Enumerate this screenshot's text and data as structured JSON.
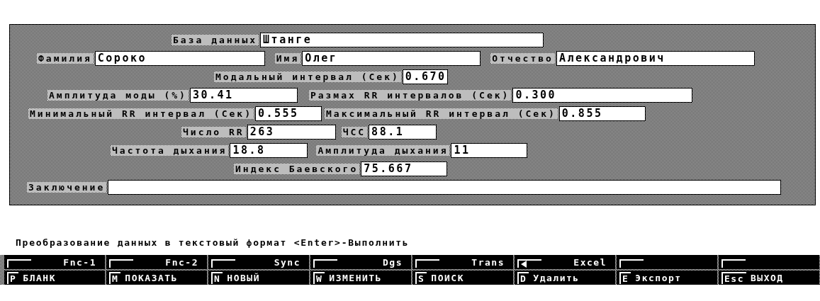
{
  "form": {
    "rows": [
      {
        "fields": [
          {
            "label": "База данных",
            "value": "Штанге"
          }
        ]
      },
      {
        "fields": [
          {
            "label": "Фамилия",
            "value": "Сороко"
          },
          {
            "label": "Имя",
            "value": "Олег"
          },
          {
            "label": "Отчество",
            "value": "Александрович"
          }
        ]
      },
      {
        "fields": [
          {
            "label": "Модальный интервал (Сек)",
            "value": "0.670"
          }
        ]
      },
      {
        "fields": [
          {
            "label": "Амплитуда моды (%)",
            "value": "30.41"
          },
          {
            "label": "Размах RR интервалов (Сек)",
            "value": "0.300"
          }
        ]
      },
      {
        "fields": [
          {
            "label": "Минимальный RR интервал (Сек)",
            "value": "0.555"
          },
          {
            "label": "Максимальный RR интервал (Сек)",
            "value": "0.855"
          }
        ]
      },
      {
        "fields": [
          {
            "label": "Число RR",
            "value": "263"
          },
          {
            "label": "ЧСС",
            "value": "88.1"
          }
        ]
      },
      {
        "fields": [
          {
            "label": "Частота дыхания",
            "value": "18.8"
          },
          {
            "label": "Амплитуда дыхания",
            "value": "11"
          }
        ]
      },
      {
        "fields": [
          {
            "label": "Индекс Баевского",
            "value": "75.667"
          }
        ]
      },
      {
        "fields": [
          {
            "label": "Заключение"
          }
        ]
      }
    ]
  },
  "status": "Преобразование данных в текстовый формат <Enter>-Выполнить",
  "function_keys": [
    {
      "label": "Fnc-1",
      "arrow": false
    },
    {
      "label": "Fnc-2",
      "arrow": false
    },
    {
      "label": "Sync",
      "arrow": false
    },
    {
      "label": "Dgs",
      "arrow": false
    },
    {
      "label": "Trans",
      "arrow": false
    },
    {
      "label": "Excel",
      "arrow": true
    },
    {
      "arrow": false
    },
    {
      "arrow": false
    }
  ],
  "command_keys": [
    {
      "hotkey": "P",
      "label": "БЛАНК"
    },
    {
      "hotkey": "M",
      "label": "ПОКАЗАТЬ"
    },
    {
      "hotkey": "N",
      "label": "НОВЫЙ"
    },
    {
      "hotkey": "W",
      "label": "ИЗМЕНИТЬ"
    },
    {
      "hotkey": "S",
      "label": "ПОИСК"
    },
    {
      "hotkey": "D",
      "label": "Удалить"
    },
    {
      "hotkey": "E",
      "label": "Экспорт"
    },
    {
      "hotkey": "Esc",
      "label": "ВЫХОД"
    }
  ]
}
